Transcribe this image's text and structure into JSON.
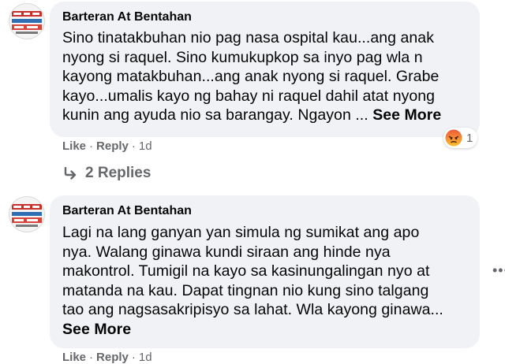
{
  "comments": [
    {
      "author": "Barteran At Bentahan",
      "text": "Sino tinatakbuhan nio pag nasa ospital kau...ang anak\nnyong si raquel. Sino kumukupkop sa inyo pag wla n\nkayong matakbuhan...ang anak nyong si raquel. Grabe\nkayo...umalis kayo ng bahay ni raquel dahil atat nyong\nkunin ang ayuda nio sa barangay. Ngayon ...",
      "see_more": "See More",
      "like_label": "Like",
      "reply_label": "Reply",
      "time": "1d",
      "reaction_count": "1",
      "reaction_type": "angry",
      "replies_label": "2 Replies"
    },
    {
      "author": "Barteran At Bentahan",
      "text": "Lagi na lang ganyan yan simula ng sumikat ang apo\nnya. Walang ginawa kundi siraan ang hinde nya\nmakontrol. Tumigil na kayo sa kasinungalingan nyo at\nmatanda na kau. Dapat tingnan nio kung sino talgang\ntao ang nagsasakripisyo sa lahat. Wla kayong ginawa...",
      "see_more": "See More",
      "like_label": "Like",
      "reply_label": "Reply",
      "time": "1d"
    }
  ],
  "colors": {
    "bubble": "#f0f2f5",
    "secondary_text": "#65676b",
    "angry_top": "#f0583b",
    "angry_bottom": "#fbbf2b"
  },
  "icons": {
    "reply_arrow": "reply-arrow-icon",
    "more_options": "more-options-icon",
    "reaction": "angry-reaction-icon"
  }
}
